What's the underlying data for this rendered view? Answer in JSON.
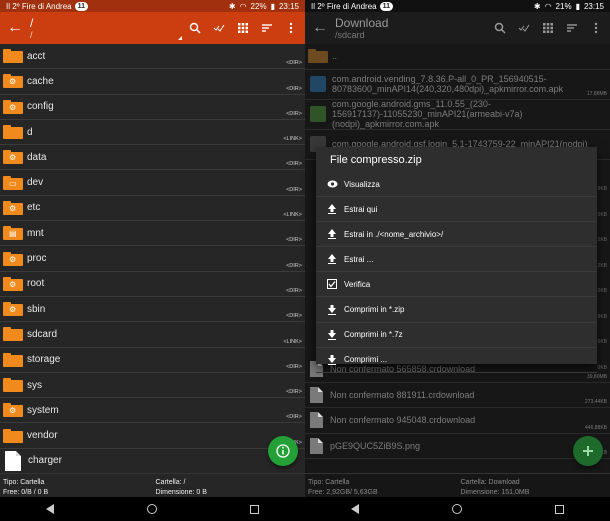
{
  "left": {
    "status": {
      "carrier": "Il 2º Fire di Andrea",
      "badge": "11",
      "battery": "22%",
      "time": "23:15"
    },
    "toolbar": {
      "title": "/",
      "subtitle": "/"
    },
    "rows": [
      {
        "name": "acct",
        "tag": "<DIR>",
        "glyph": ""
      },
      {
        "name": "cache",
        "tag": "<DIR>",
        "glyph": "⚙"
      },
      {
        "name": "config",
        "tag": "<DIR>",
        "glyph": "⚙"
      },
      {
        "name": "d",
        "tag": "<LINK>",
        "glyph": ""
      },
      {
        "name": "data",
        "tag": "<DIR>",
        "glyph": "⚙"
      },
      {
        "name": "dev",
        "tag": "<DIR>",
        "glyph": "▭"
      },
      {
        "name": "etc",
        "tag": "<LINK>",
        "glyph": "⚙"
      },
      {
        "name": "mnt",
        "tag": "<DIR>",
        "glyph": "▤"
      },
      {
        "name": "proc",
        "tag": "<DIR>",
        "glyph": "⚙"
      },
      {
        "name": "root",
        "tag": "<DIR>",
        "glyph": "⚙"
      },
      {
        "name": "sbin",
        "tag": "<DIR>",
        "glyph": "⚙"
      },
      {
        "name": "sdcard",
        "tag": "<LINK>",
        "glyph": ""
      },
      {
        "name": "storage",
        "tag": "<DIR>",
        "glyph": ""
      },
      {
        "name": "sys",
        "tag": "<DIR>",
        "glyph": ""
      },
      {
        "name": "system",
        "tag": "<DIR>",
        "glyph": "⚙"
      },
      {
        "name": "vendor",
        "tag": "<LINK>",
        "glyph": ""
      },
      {
        "name": "charger",
        "tag": "",
        "glyph": "file"
      }
    ],
    "footer": {
      "type": "Tipo: Cartella",
      "free": "Free: 0/B / 0 B",
      "folder": "Cartella: /",
      "size": "Dimensione: 0 B"
    },
    "fab_icon": "info-icon"
  },
  "right": {
    "status": {
      "carrier": "Il 2º Fire di Andrea",
      "badge": "11",
      "battery": "21%",
      "time": "23:15"
    },
    "toolbar": {
      "title": "Download",
      "subtitle": "/sdcard"
    },
    "up_row": "..",
    "rows_top": [
      {
        "name": "com.android.vending_7.8.36.P-all_0_PR_156940515-80783600_minAPI14(240,320,480dpi)_apkmirror.com.apk",
        "tag": "17,88MB",
        "color": "#2a7ab5"
      },
      {
        "name": "com.google.android.gms_11.0.55_(230-156917137)-11055230_minAPI21(armeabi-v7a)(nodpi)_apkmirror.com.apk",
        "tag": "",
        "color": "#4a8f3a"
      },
      {
        "name": "com.google.android.gsf.login_5.1-1743759-22_minAPI21(nodpi)",
        "tag": "",
        "color": "#5a5a5a"
      }
    ],
    "side_tags": [
      "9KB",
      "0KB",
      "5KB",
      "2KB",
      "0KB",
      "8KB",
      "6KB",
      "0KB"
    ],
    "rows_bottom": [
      {
        "name": "Non confermato 565858.crdownload",
        "tag": "39,80MB"
      },
      {
        "name": "Non confermato 881911.crdownload",
        "tag": "273,44KB"
      },
      {
        "name": "Non confermato 945048.crdownload",
        "tag": "446,88KB"
      },
      {
        "name": "pGE9QUC5ZiB9S.png",
        "tag": "6,8KB"
      }
    ],
    "footer": {
      "type": "Tipo: Cartella",
      "free": "Free: 2,92GB/ 5,63GB",
      "folder": "Cartella: Download",
      "size": "Dimensione: 151,0MB"
    },
    "fab_icon": "plus-icon"
  },
  "dialog": {
    "title": "File compresso.zip",
    "items": [
      {
        "label": "Visualizza",
        "icon": "eye-icon"
      },
      {
        "label": "Estrai qui",
        "icon": "upload-icon"
      },
      {
        "label": "Estrai in ./<nome_archivio>/",
        "icon": "upload-icon"
      },
      {
        "label": "Estrai ...",
        "icon": "upload-icon"
      },
      {
        "label": "Verifica",
        "icon": "checkbox-icon"
      },
      {
        "label": "Comprimi in *.zip",
        "icon": "download-icon"
      },
      {
        "label": "Comprimi in *.7z",
        "icon": "download-icon"
      },
      {
        "label": "Comprimi ...",
        "icon": "download-icon"
      }
    ]
  }
}
